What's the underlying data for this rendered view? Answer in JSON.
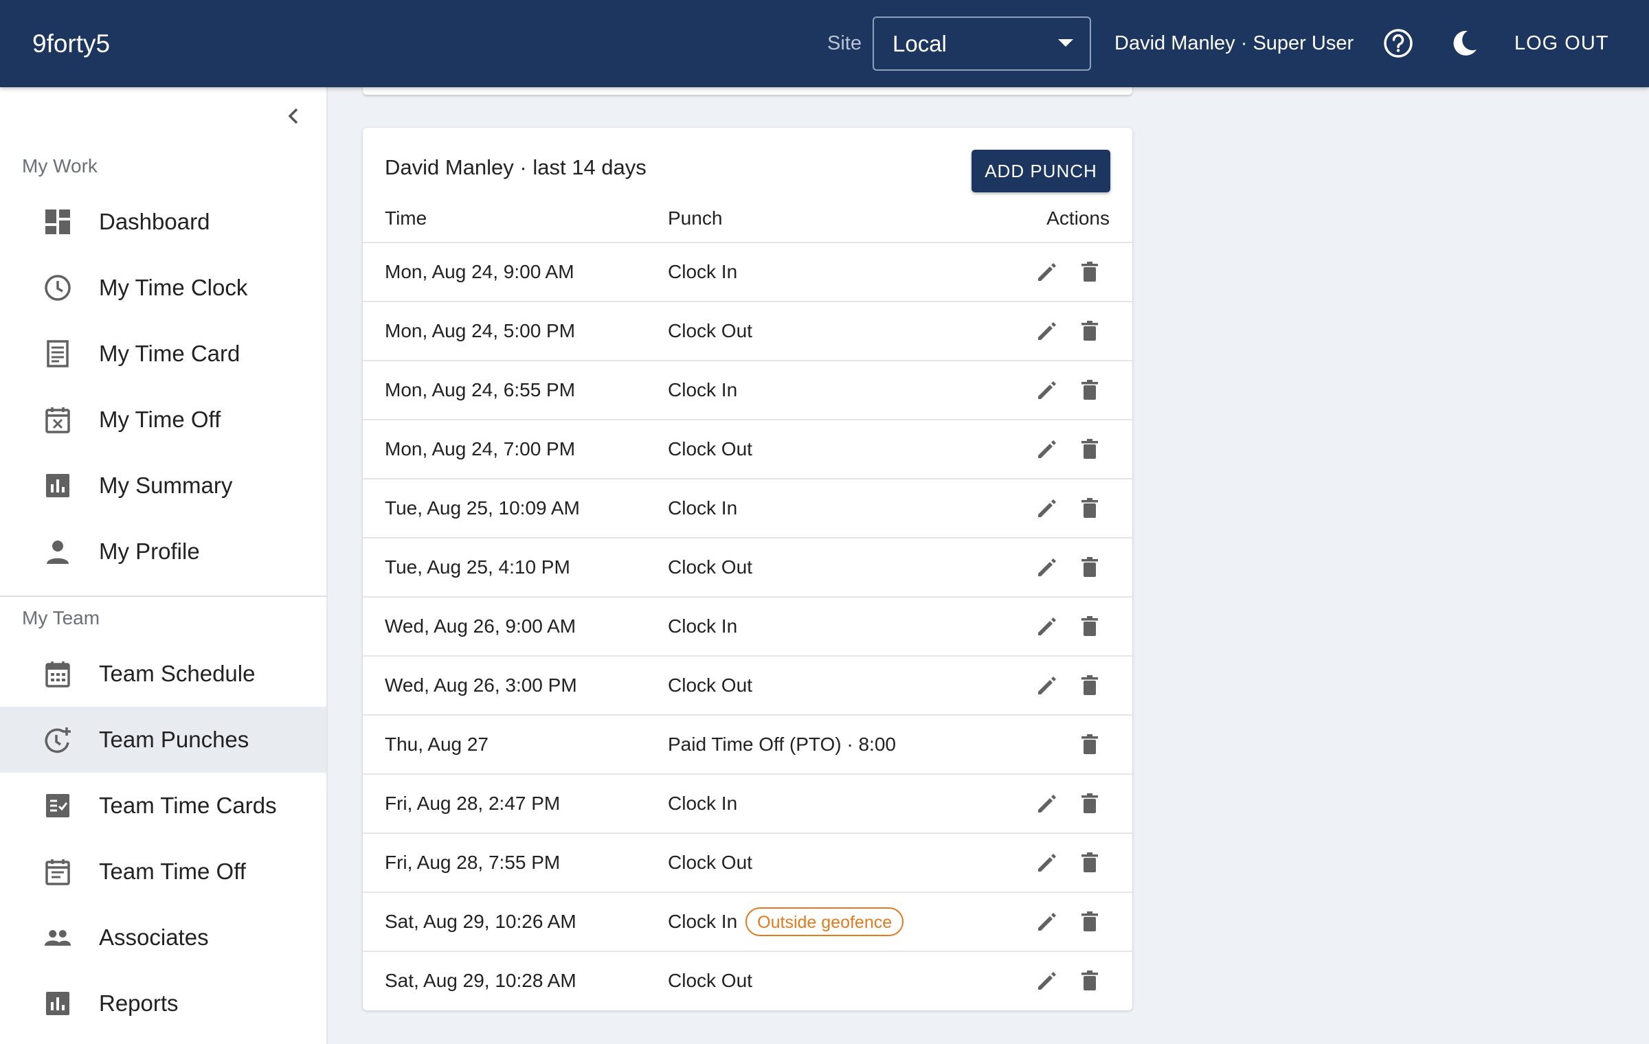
{
  "header": {
    "brand": "9forty5",
    "site_label": "Site",
    "site_value": "Local",
    "user": "David Manley · Super User",
    "logout_label": "LOG OUT",
    "bg_color": "#1d3660"
  },
  "sidebar": {
    "my_work_label": "My Work",
    "my_team_label": "My Team",
    "my_work_items": [
      {
        "label": "Dashboard",
        "icon": "dashboard-icon"
      },
      {
        "label": "My Time Clock",
        "icon": "clock-icon"
      },
      {
        "label": "My Time Card",
        "icon": "receipt-icon"
      },
      {
        "label": "My Time Off",
        "icon": "calendar-x-icon"
      },
      {
        "label": "My Summary",
        "icon": "bar-chart-icon"
      },
      {
        "label": "My Profile",
        "icon": "person-icon"
      }
    ],
    "my_team_items": [
      {
        "label": "Team Schedule",
        "icon": "calendar-grid-icon"
      },
      {
        "label": "Team Punches",
        "icon": "clock-plus-icon",
        "active": true
      },
      {
        "label": "Team Time Cards",
        "icon": "checklist-icon"
      },
      {
        "label": "Team Time Off",
        "icon": "calendar-note-icon"
      },
      {
        "label": "Associates",
        "icon": "people-icon"
      },
      {
        "label": "Reports",
        "icon": "bar-chart-icon"
      }
    ]
  },
  "main": {
    "card_title": "David Manley · last 14 days",
    "add_button": "ADD PUNCH",
    "columns": {
      "time": "Time",
      "punch": "Punch",
      "actions": "Actions"
    },
    "rows": [
      {
        "time": "Mon, Aug 24, 9:00 AM",
        "punch": "Clock In",
        "editable": true
      },
      {
        "time": "Mon, Aug 24, 5:00 PM",
        "punch": "Clock Out",
        "editable": true
      },
      {
        "time": "Mon, Aug 24, 6:55 PM",
        "punch": "Clock In",
        "editable": true
      },
      {
        "time": "Mon, Aug 24, 7:00 PM",
        "punch": "Clock Out",
        "editable": true
      },
      {
        "time": "Tue, Aug 25, 10:09 AM",
        "punch": "Clock In",
        "editable": true
      },
      {
        "time": "Tue, Aug 25, 4:10 PM",
        "punch": "Clock Out",
        "editable": true
      },
      {
        "time": "Wed, Aug 26, 9:00 AM",
        "punch": "Clock In",
        "editable": true
      },
      {
        "time": "Wed, Aug 26, 3:00 PM",
        "punch": "Clock Out",
        "editable": true
      },
      {
        "time": "Thu, Aug 27",
        "punch": "Paid Time Off (PTO) · 8:00",
        "editable": false
      },
      {
        "time": "Fri, Aug 28, 2:47 PM",
        "punch": "Clock In",
        "editable": true
      },
      {
        "time": "Fri, Aug 28, 7:55 PM",
        "punch": "Clock Out",
        "editable": true
      },
      {
        "time": "Sat, Aug 29, 10:26 AM",
        "punch": "Clock In",
        "badge": "Outside geofence",
        "editable": true
      },
      {
        "time": "Sat, Aug 29, 10:28 AM",
        "punch": "Clock Out",
        "editable": true
      }
    ],
    "badge_color": "#e07b1f"
  }
}
